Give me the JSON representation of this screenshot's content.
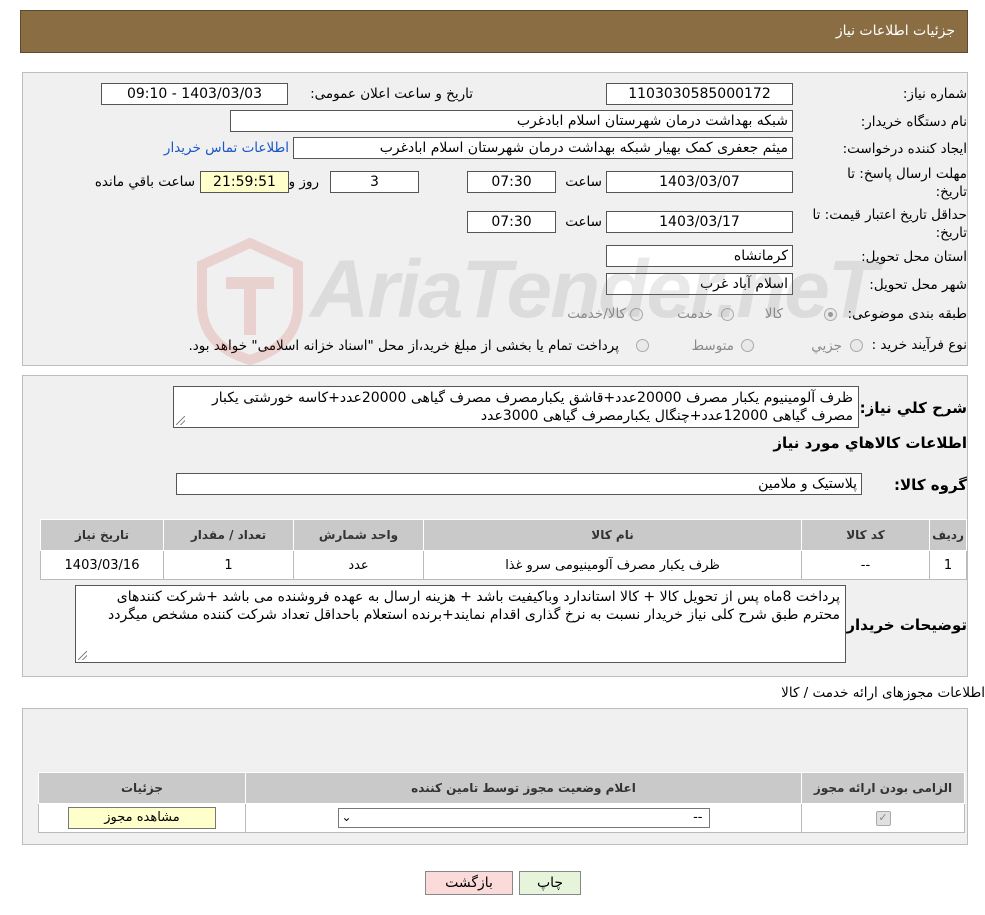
{
  "header": {
    "title": "جزئیات اطلاعات نیاز"
  },
  "form": {
    "need_number_label": "شماره نیاز:",
    "need_number": "1103030585000172",
    "announce_label": "تاریخ و ساعت اعلان عمومی:",
    "announce_value": "1403/03/03 - 09:10",
    "buyer_org_label": "نام دستگاه خریدار:",
    "buyer_org": "شبکه بهداشت درمان شهرستان اسلام ابادغرب",
    "creator_label": "ایجاد کننده درخواست:",
    "creator": "میثم جعفری کمک بهیار شبکه بهداشت درمان شهرستان اسلام ابادغرب",
    "contact_link": "اطلاعات تماس خریدار",
    "reply_deadline_label_1": "مهلت ارسال پاسخ: تا",
    "reply_deadline_label_2": "تاریخ:",
    "reply_date": "1403/03/07",
    "time_label": "ساعت",
    "reply_time": "07:30",
    "days_value": "3",
    "days_label": "روز و",
    "remaining_time": "21:59:51",
    "remaining_label": "ساعت باقي مانده",
    "price_validity_label_1": "حداقل تاریخ اعتبار قیمت: تا",
    "price_validity_label_2": "تاریخ:",
    "price_date": "1403/03/17",
    "price_time": "07:30",
    "province_label": "استان محل تحویل:",
    "province": "کرمانشاه",
    "city_label": "شهر محل تحویل:",
    "city": "اسلام آباد غرب",
    "category_label": "طبقه بندی موضوعی:",
    "category_options": [
      "کالا",
      "خدمت",
      "کالا/خدمت"
    ],
    "process_label": "نوع فرآیند خرید :",
    "process_options": [
      "جزیي",
      "متوسط"
    ],
    "payment_note": "پرداخت تمام یا بخشی از مبلغ خرید،از محل \"اسناد خزانه اسلامی\" خواهد بود."
  },
  "summary": {
    "title": "شرح کلي نیاز:",
    "text": "ظرف آلومینیوم یکبار مصرف 20000عدد+قاشق یکبارمصرف مصرف گیاهی 20000عدد+کاسه خورشتی یکبار مصرف گیاهی 12000عدد+چنگال یکبارمصرف گیاهی 3000عدد",
    "goods_info_title": "اطلاعات کالاهاي مورد نیاز",
    "group_label": "گروه کالا:",
    "group_value": "پلاستیک و ملامین"
  },
  "goods_table": {
    "headers": [
      "ردیف",
      "کد کالا",
      "نام کالا",
      "واحد شمارش",
      "تعداد / مقدار",
      "تاریخ نیاز"
    ],
    "rows": [
      [
        "1",
        "--",
        "ظرف یکبار مصرف آلومینیومی سرو غذا",
        "عدد",
        "1",
        "1403/03/16"
      ]
    ]
  },
  "buyer_notes": {
    "label": "توضیحات خریدار:",
    "text": "پرداخت 8ماه  پس از تحویل کالا + کالا استاندارد وباکیفیت  باشد + هزینه ارسال به عهده فروشنده می باشد +شرکت کنندهای محترم طبق شرح کلی نیاز خریدار نسبت به نرخ گذاری اقدام نمایند+برنده استعلام باحداقل تعداد شرکت کننده مشخص میگردد"
  },
  "permits": {
    "section_title": "اطلاعات مجوزهای ارائه خدمت / کالا",
    "headers": [
      "الزامی بودن ارائه مجوز",
      "اعلام وضعیت مجوز توسط تامین کننده",
      "جزئیات"
    ],
    "select_value": "--",
    "view_button": "مشاهده مجوز"
  },
  "actions": {
    "print": "چاپ",
    "back": "بازگشت"
  },
  "watermark": {
    "text": "AriaTender.neT"
  },
  "colors": {
    "header": "#8a6d43",
    "link": "#1a55c9",
    "back_button": "#fbdada",
    "print_button": "#e6f4dc"
  }
}
